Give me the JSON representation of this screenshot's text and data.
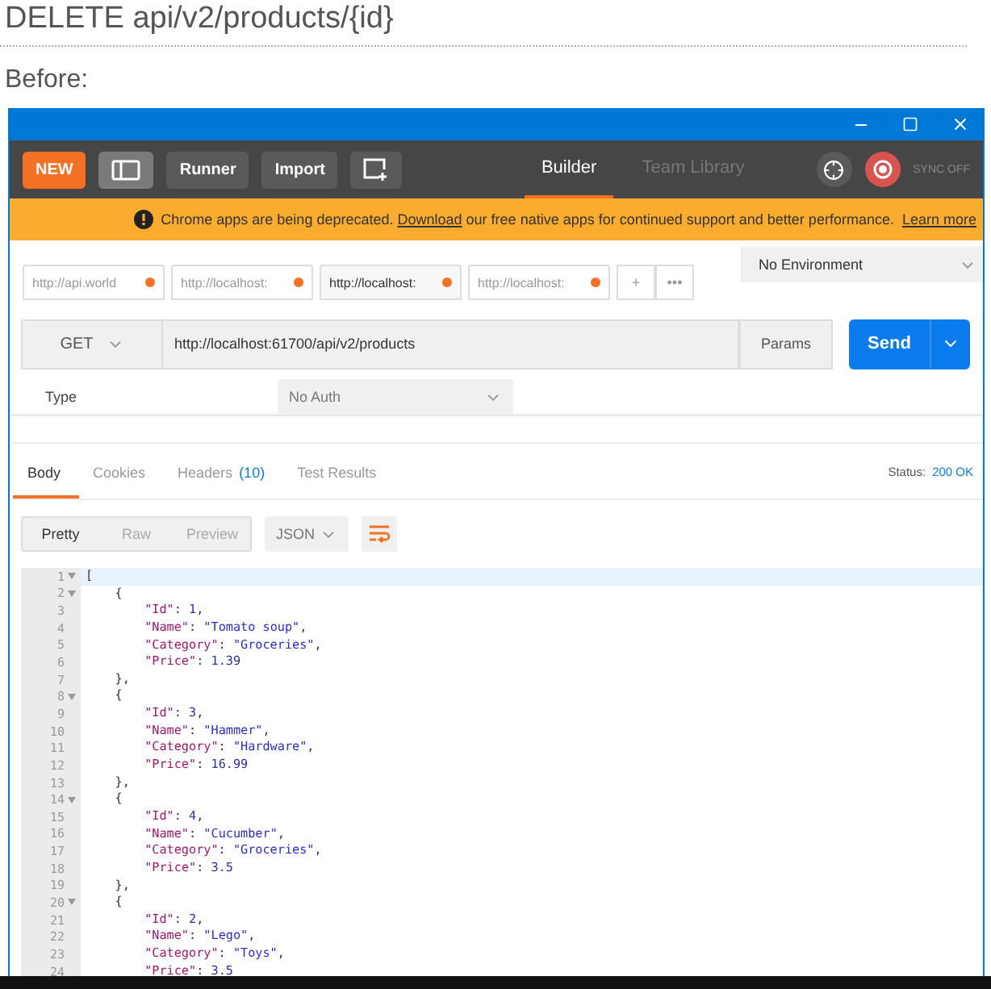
{
  "heading": "DELETE api/v2/products/{id}",
  "caption": "Before:",
  "toolbar": {
    "new_button": "NEW",
    "buttons": [
      "Runner",
      "Import"
    ],
    "tabs": [
      {
        "label": "Builder",
        "selected": true
      },
      {
        "label": "Team Library",
        "selected": false
      }
    ],
    "sync_status": "SYNC OFF"
  },
  "banner": {
    "before": "Chrome apps are being deprecated.",
    "link": "Download",
    "after": "our free native apps for continued support and better performance.",
    "more_link": "Learn more"
  },
  "request_tabs": [
    {
      "label": "http://api.world",
      "selected": false,
      "unsaved": true
    },
    {
      "label": "http://localhost:",
      "selected": false,
      "unsaved": true
    },
    {
      "label": "http://localhost:",
      "selected": true,
      "unsaved": true
    },
    {
      "label": "http://localhost:",
      "selected": false,
      "unsaved": true
    }
  ],
  "add_tab": "+",
  "more_tabs": "•••",
  "environment": "No Environment",
  "request": {
    "method": "GET",
    "url": "http://localhost:61700/api/v2/products",
    "params": "Params",
    "send": "Send"
  },
  "auth": {
    "label": "Type",
    "value": "No Auth"
  },
  "response_tabs": [
    {
      "label": "Body",
      "selected": true
    },
    {
      "label": "Cookies",
      "selected": false
    },
    {
      "label": "Headers",
      "count": "(10)",
      "selected": false
    },
    {
      "label": "Test Results",
      "selected": false
    }
  ],
  "status": {
    "label": "Status:",
    "value": "200 OK"
  },
  "view_modes": [
    {
      "label": "Pretty",
      "selected": true
    },
    {
      "label": "Raw",
      "selected": false
    },
    {
      "label": "Preview",
      "selected": false
    }
  ],
  "format": "JSON",
  "code_lines": [
    {
      "number": "1",
      "foldable": true,
      "text": "["
    },
    {
      "number": "2",
      "foldable": true,
      "text": "    {"
    },
    {
      "number": "3",
      "foldable": false,
      "text": "        \"Id\": 1,"
    },
    {
      "number": "4",
      "foldable": false,
      "text": "        \"Name\": \"Tomato soup\","
    },
    {
      "number": "5",
      "foldable": false,
      "text": "        \"Category\": \"Groceries\","
    },
    {
      "number": "6",
      "foldable": false,
      "text": "        \"Price\": 1.39"
    },
    {
      "number": "7",
      "foldable": false,
      "text": "    },"
    },
    {
      "number": "8",
      "foldable": true,
      "text": "    {"
    },
    {
      "number": "9",
      "foldable": false,
      "text": "        \"Id\": 3,"
    },
    {
      "number": "10",
      "foldable": false,
      "text": "        \"Name\": \"Hammer\","
    },
    {
      "number": "11",
      "foldable": false,
      "text": "        \"Category\": \"Hardware\","
    },
    {
      "number": "12",
      "foldable": false,
      "text": "        \"Price\": 16.99"
    },
    {
      "number": "13",
      "foldable": false,
      "text": "    },"
    },
    {
      "number": "14",
      "foldable": true,
      "text": "    {"
    },
    {
      "number": "15",
      "foldable": false,
      "text": "        \"Id\": 4,"
    },
    {
      "number": "16",
      "foldable": false,
      "text": "        \"Name\": \"Cucumber\","
    },
    {
      "number": "17",
      "foldable": false,
      "text": "        \"Category\": \"Groceries\","
    },
    {
      "number": "18",
      "foldable": false,
      "text": "        \"Price\": 3.5"
    },
    {
      "number": "19",
      "foldable": false,
      "text": "    },"
    },
    {
      "number": "20",
      "foldable": true,
      "text": "    {"
    },
    {
      "number": "21",
      "foldable": false,
      "text": "        \"Id\": 2,"
    },
    {
      "number": "22",
      "foldable": false,
      "text": "        \"Name\": \"Lego\","
    },
    {
      "number": "23",
      "foldable": false,
      "text": "        \"Category\": \"Toys\","
    },
    {
      "number": "24",
      "foldable": false,
      "text": "        \"Price\": 3.5"
    }
  ]
}
